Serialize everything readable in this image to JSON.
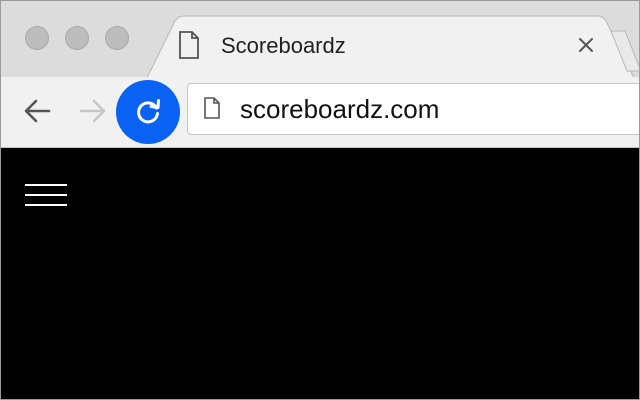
{
  "browser": {
    "tab": {
      "title": "Scoreboardz",
      "page_icon": "page-icon",
      "close_icon": "close-icon"
    },
    "window_controls": [
      "close-dot",
      "minimize-dot",
      "zoom-dot"
    ],
    "toolbar": {
      "back_icon": "arrow-left-icon",
      "forward_icon": "arrow-right-icon",
      "reload_icon": "reload-icon",
      "reload_color": "#0a62f4",
      "url": "scoreboardz.com"
    }
  },
  "page": {
    "background": "#000000",
    "menu_icon": "hamburger-menu-icon"
  }
}
